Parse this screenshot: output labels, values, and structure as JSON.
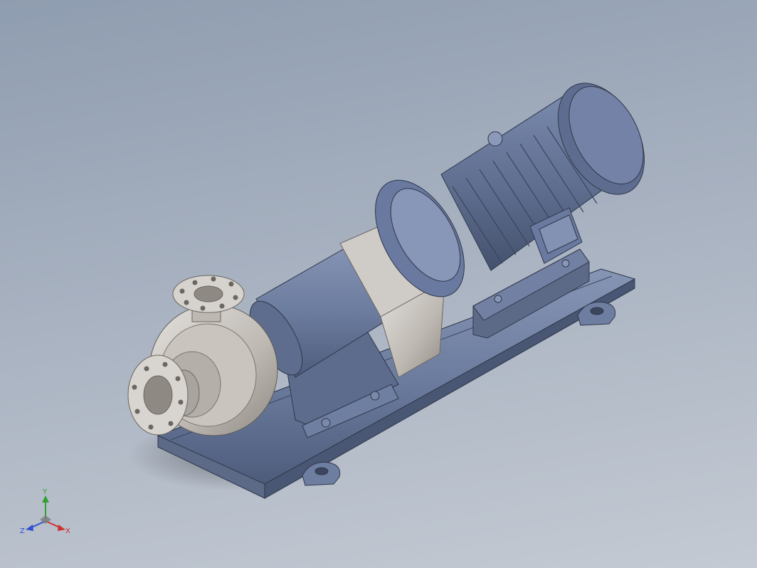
{
  "viewport": {
    "colors": {
      "background_top": "#8f9db0",
      "background_bottom": "#c4cad3",
      "body_blue": "#6d7d9f",
      "body_blue_dark": "#4e5c7c",
      "steel_light": "#d6d3cf",
      "steel_mid": "#aaa6a1"
    }
  },
  "model": {
    "subject": "pump-motor-assembly-on-baseplate"
  },
  "triad": {
    "y_label": "Y",
    "x_label": "X",
    "z_label": "Z",
    "colors": {
      "x": "#d03030",
      "y": "#30a030",
      "z": "#3050d0"
    }
  }
}
